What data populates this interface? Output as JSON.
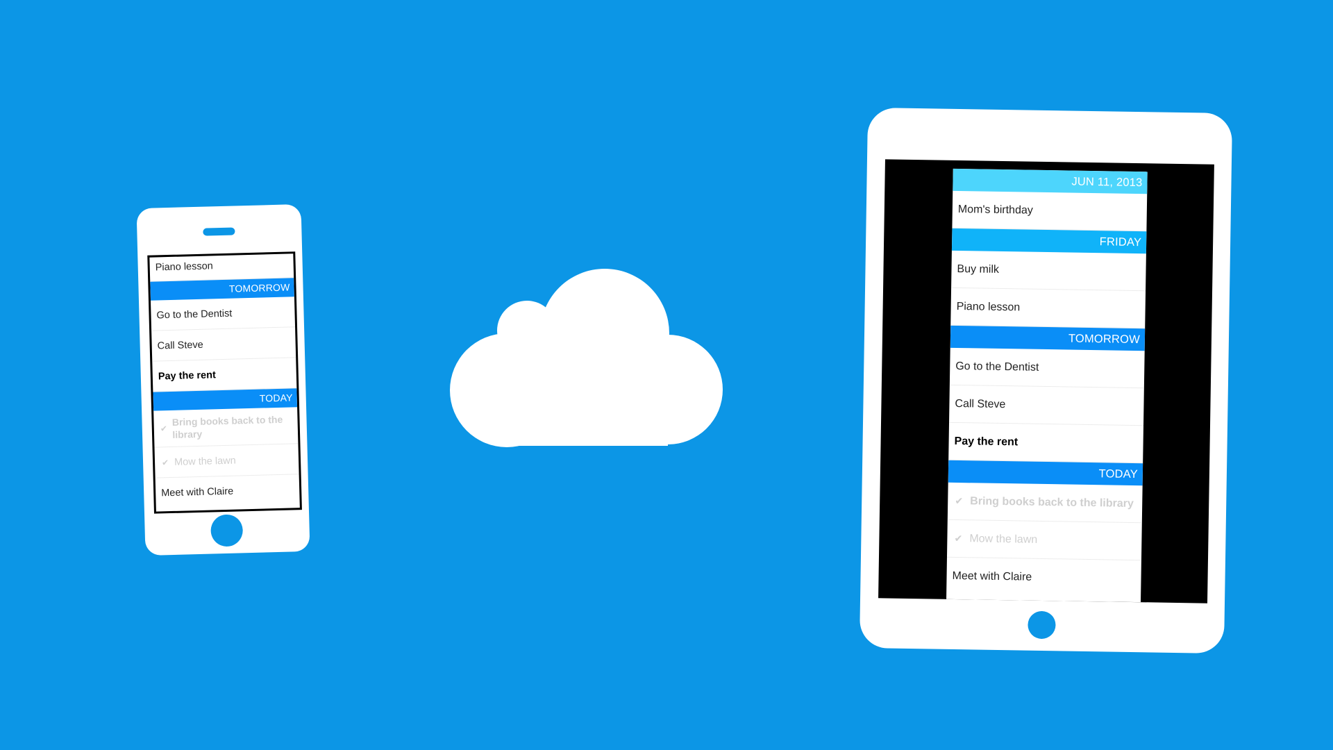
{
  "colors": {
    "background": "#0c96e6",
    "header_date": "#4dd5fc",
    "header_day": "#10b3f9",
    "header_near": "#0a8ef7",
    "done_text": "#cfcfcf"
  },
  "cloud": {
    "icon": "cloud-icon"
  },
  "phone": {
    "list": [
      {
        "type": "row",
        "text": "Piano lesson",
        "style": "normal",
        "partial": true
      },
      {
        "type": "header",
        "text": "TOMORROW",
        "tone": "near"
      },
      {
        "type": "row",
        "text": "Go to the Dentist",
        "style": "normal"
      },
      {
        "type": "row",
        "text": "Call Steve",
        "style": "normal"
      },
      {
        "type": "row",
        "text": "Pay the rent",
        "style": "bold"
      },
      {
        "type": "header",
        "text": "TODAY",
        "tone": "near"
      },
      {
        "type": "row",
        "text": "Bring books back to the library",
        "style": "done-bold",
        "checked": true
      },
      {
        "type": "row",
        "text": "Mow the lawn",
        "style": "done",
        "checked": true
      },
      {
        "type": "row",
        "text": "Meet with Claire",
        "style": "normal"
      }
    ]
  },
  "tablet": {
    "list": [
      {
        "type": "header",
        "text": "JUN 11, 2013",
        "tone": "date"
      },
      {
        "type": "row",
        "text": "Mom's birthday",
        "style": "normal"
      },
      {
        "type": "header",
        "text": "FRIDAY",
        "tone": "day"
      },
      {
        "type": "row",
        "text": "Buy milk",
        "style": "normal"
      },
      {
        "type": "row",
        "text": "Piano lesson",
        "style": "normal"
      },
      {
        "type": "header",
        "text": "TOMORROW",
        "tone": "near"
      },
      {
        "type": "row",
        "text": "Go to the Dentist",
        "style": "normal"
      },
      {
        "type": "row",
        "text": "Call Steve",
        "style": "normal"
      },
      {
        "type": "row",
        "text": "Pay the rent",
        "style": "bold"
      },
      {
        "type": "header",
        "text": "TODAY",
        "tone": "near"
      },
      {
        "type": "row",
        "text": "Bring books back to the library",
        "style": "done-bold",
        "checked": true
      },
      {
        "type": "row",
        "text": "Mow the lawn",
        "style": "done",
        "checked": true
      },
      {
        "type": "row",
        "text": "Meet with Claire",
        "style": "normal"
      }
    ]
  },
  "icons": {
    "check": "✔"
  }
}
